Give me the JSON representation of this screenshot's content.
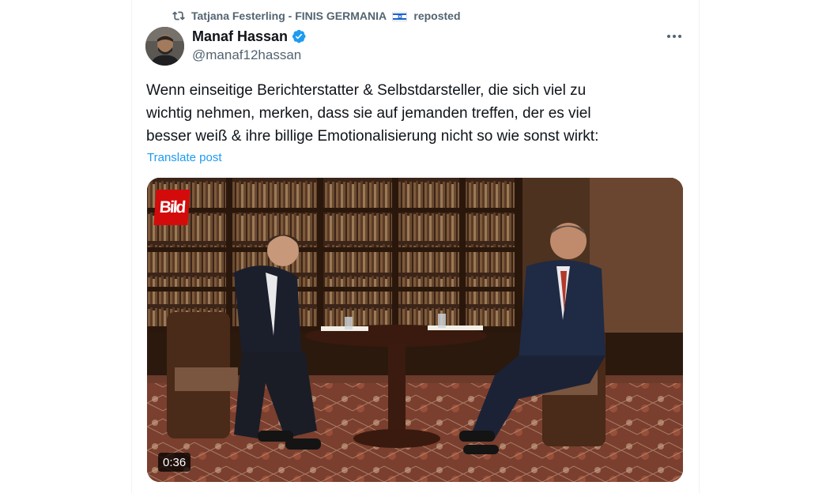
{
  "repost": {
    "reposter_name": "Tatjana Festerling - FINIS GERMANIA",
    "flag_icon": "israel-flag-icon",
    "reposted_label": "reposted"
  },
  "post": {
    "author": {
      "display_name": "Manaf Hassan",
      "handle": "@manaf12hassan",
      "verified": true,
      "verified_color": "#1d9bf0"
    },
    "text": "Wenn einseitige Berichterstatter & Selbstdarsteller, die sich viel zu\nwichtig nehmen, merken, dass sie auf jemanden treffen, der es viel\nbesser weiß & ihre billige Emotionalisierung nicht so wie sonst wirkt:",
    "translate_label": "Translate post",
    "media": {
      "logo_text": "Bild",
      "duration": "0:36"
    }
  },
  "colors": {
    "accent": "#1d9bf0",
    "secondary_text": "#536471",
    "primary_text": "#0f1419",
    "bild_red": "#d40b0b"
  },
  "icons": {
    "repost": "repost-icon",
    "verified": "verified-badge-icon",
    "more": "more-options-icon"
  }
}
